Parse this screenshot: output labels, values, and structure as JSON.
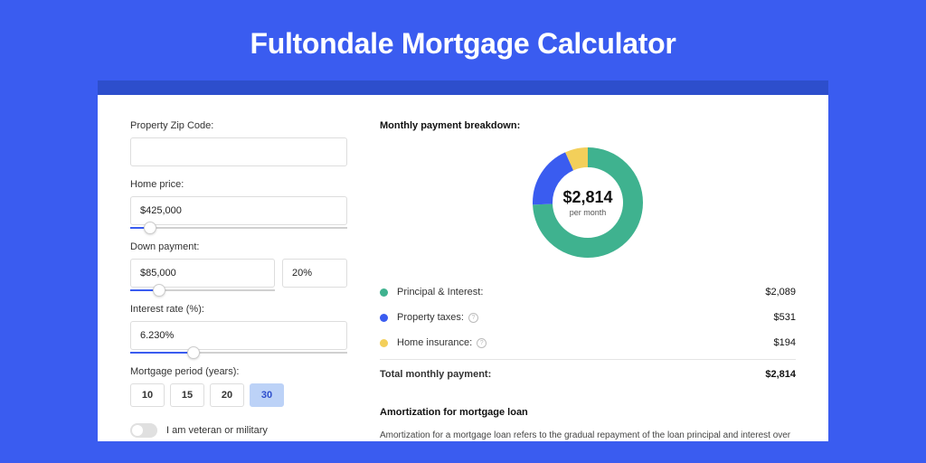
{
  "page_title": "Fultondale Mortgage Calculator",
  "form": {
    "zip_label": "Property Zip Code:",
    "zip_value": "",
    "home_price_label": "Home price:",
    "home_price_value": "$425,000",
    "home_price_slider_pct": 9,
    "down_payment_label": "Down payment:",
    "down_payment_value": "$85,000",
    "down_payment_pct_value": "20%",
    "down_payment_slider_pct": 20,
    "interest_label": "Interest rate (%):",
    "interest_value": "6.230%",
    "interest_slider_pct": 29,
    "period_label": "Mortgage period (years):",
    "period_options": [
      "10",
      "15",
      "20",
      "30"
    ],
    "period_selected": "30",
    "veteran_label": "I am veteran or military"
  },
  "breakdown": {
    "title": "Monthly payment breakdown:",
    "donut_amount": "$2,814",
    "donut_sub": "per month",
    "items": [
      {
        "label": "Principal & Interest:",
        "value": "$2,089",
        "color": "#3fb28f",
        "info": false
      },
      {
        "label": "Property taxes:",
        "value": "$531",
        "color": "#3a5cf0",
        "info": true
      },
      {
        "label": "Home insurance:",
        "value": "$194",
        "color": "#f3cf5a",
        "info": true
      }
    ],
    "total_label": "Total monthly payment:",
    "total_value": "$2,814"
  },
  "amortization": {
    "title": "Amortization for mortgage loan",
    "text": "Amortization for a mortgage loan refers to the gradual repayment of the loan principal and interest over a specified"
  },
  "chart_data": {
    "type": "pie",
    "title": "Monthly payment breakdown",
    "series": [
      {
        "name": "Principal & Interest",
        "value": 2089,
        "pct": 74.2,
        "color": "#3fb28f"
      },
      {
        "name": "Property taxes",
        "value": 531,
        "pct": 18.9,
        "color": "#3a5cf0"
      },
      {
        "name": "Home insurance",
        "value": 194,
        "pct": 6.9,
        "color": "#f3cf5a"
      }
    ],
    "total": 2814,
    "center_label": "$2,814 per month"
  }
}
